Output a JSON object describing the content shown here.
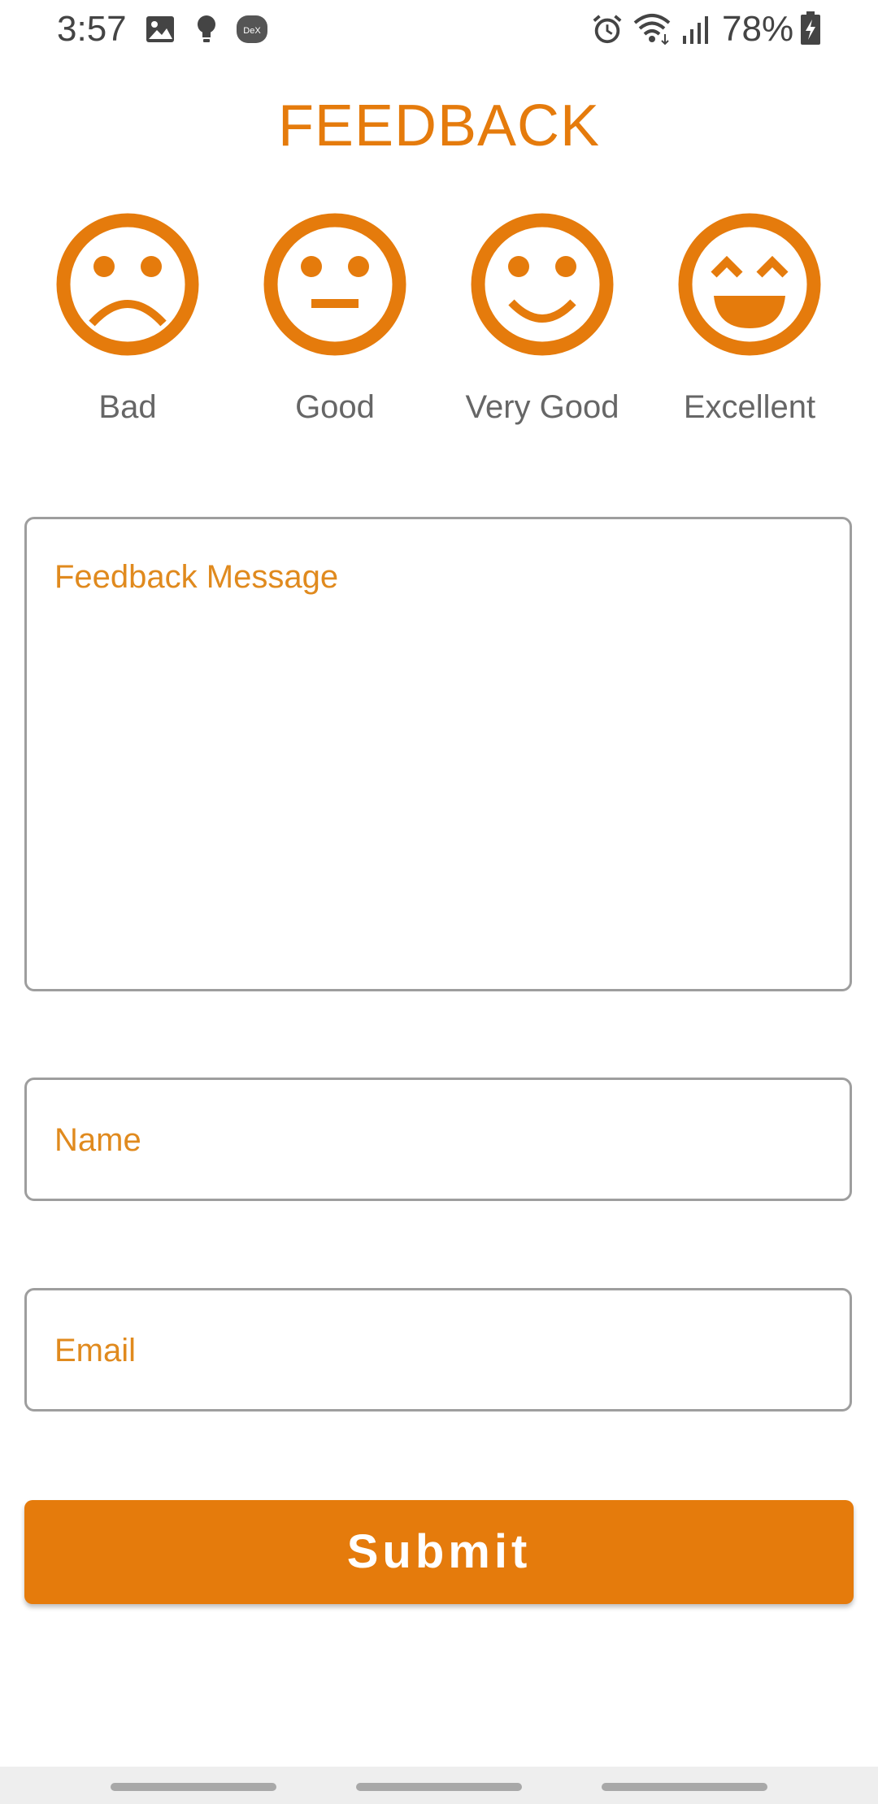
{
  "status_bar": {
    "time": "3:57",
    "battery_percent": "78%",
    "icons": [
      "image-icon",
      "lightbulb-icon",
      "dex-icon",
      "alarm-icon",
      "wifi-icon",
      "signal-icon",
      "battery-charging-icon"
    ],
    "dex_label": "DeX"
  },
  "title": "FEEDBACK",
  "ratings": [
    {
      "label": "Bad",
      "icon": "sad-face-icon"
    },
    {
      "label": "Good",
      "icon": "neutral-face-icon"
    },
    {
      "label": "Very Good",
      "icon": "smile-face-icon"
    },
    {
      "label": "Excellent",
      "icon": "laughing-face-icon"
    }
  ],
  "form": {
    "message_placeholder": "Feedback Message",
    "name_placeholder": "Name",
    "email_placeholder": "Email"
  },
  "submit_label": "Submit",
  "colors": {
    "accent": "#e57b0c",
    "placeholder": "#e08a1e",
    "label_gray": "#666666",
    "border": "#9e9e9e"
  }
}
